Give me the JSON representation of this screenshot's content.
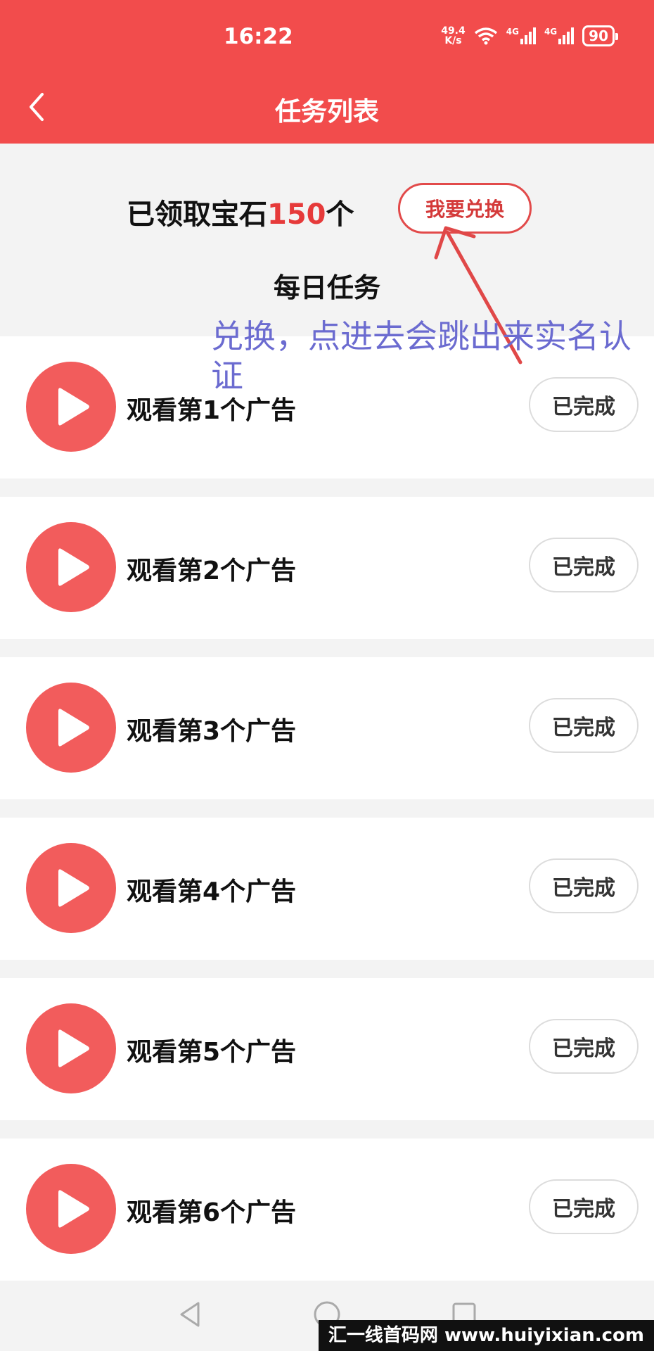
{
  "status_bar": {
    "time": "16:22",
    "net_speed_value": "49.4",
    "net_speed_unit": "K/s",
    "signal_1": "4G",
    "signal_2": "4G",
    "battery": "90"
  },
  "header": {
    "title": "任务列表"
  },
  "summary": {
    "gem_prefix": "已领取宝石",
    "gem_count": "150",
    "gem_suffix": "个",
    "redeem_label": "我要兑换",
    "daily_title": "每日任务"
  },
  "annotation": {
    "text": "兑换，点进去会跳出来实名认证"
  },
  "tasks": [
    {
      "label": "观看第1个广告",
      "status": "已完成"
    },
    {
      "label": "观看第2个广告",
      "status": "已完成"
    },
    {
      "label": "观看第3个广告",
      "status": "已完成"
    },
    {
      "label": "观看第4个广告",
      "status": "已完成"
    },
    {
      "label": "观看第5个广告",
      "status": "已完成"
    },
    {
      "label": "观看第6个广告",
      "status": "已完成"
    }
  ],
  "watermark": "汇一线首码网 www.huiyixian.com",
  "colors": {
    "header_bg": "#f24c4c",
    "accent": "#e63a3a",
    "annotation": "#6b6bd0"
  }
}
